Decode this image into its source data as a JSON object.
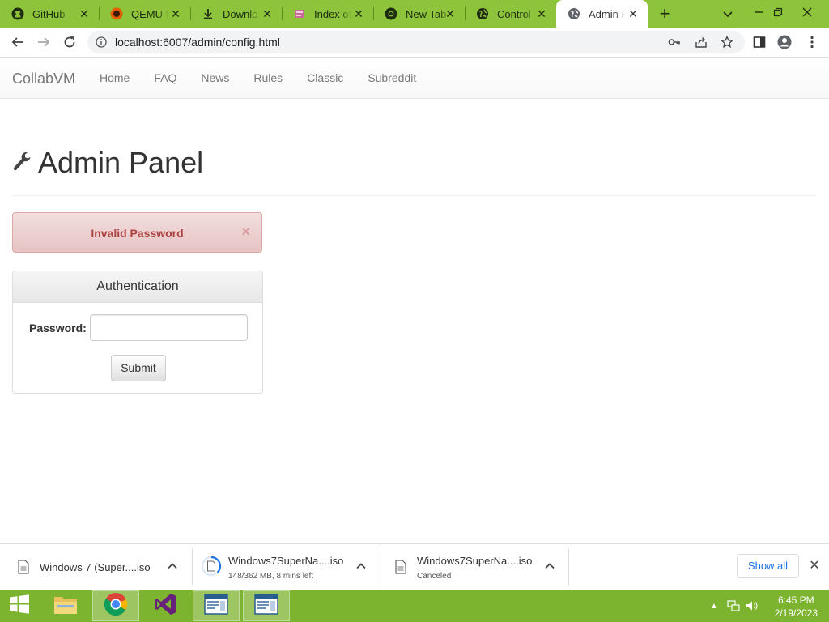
{
  "browser": {
    "tabs": [
      {
        "title": "GitHub - ",
        "icon": "github-icon"
      },
      {
        "title": "QEMU fo",
        "icon": "qemu-icon"
      },
      {
        "title": "Downloa",
        "icon": "download-icon"
      },
      {
        "title": "Index of",
        "icon": "folder-index-icon"
      },
      {
        "title": "New Tab",
        "icon": "chrome-icon"
      },
      {
        "title": "Control C",
        "icon": "globe-icon"
      },
      {
        "title": "Admin P",
        "icon": "globe-icon",
        "active": true
      }
    ],
    "url": "localhost:6007/admin/config.html"
  },
  "site": {
    "brand": "CollabVM",
    "nav": [
      "Home",
      "FAQ",
      "News",
      "Rules",
      "Classic",
      "Subreddit"
    ]
  },
  "page": {
    "title": "Admin Panel",
    "alert": {
      "message": "Invalid Password",
      "close": "×"
    },
    "auth": {
      "heading": "Authentication",
      "password_label": "Password:",
      "password_value": "",
      "submit_label": "Submit"
    }
  },
  "downloads": {
    "items": [
      {
        "name": "Windows 7 (Super....iso",
        "status": ""
      },
      {
        "name": "Windows7SuperNa....iso",
        "status": "148/362 MB, 8 mins left"
      },
      {
        "name": "Windows7SuperNa....iso",
        "status": "Canceled"
      }
    ],
    "show_all": "Show all"
  },
  "taskbar": {
    "time": "6:45 PM",
    "date": "2/19/2023"
  },
  "colors": {
    "chrome_frame": "#8dc43b",
    "taskbar": "#7cb32f",
    "alert_text": "#a94442",
    "alert_bg": "#f2dede"
  }
}
